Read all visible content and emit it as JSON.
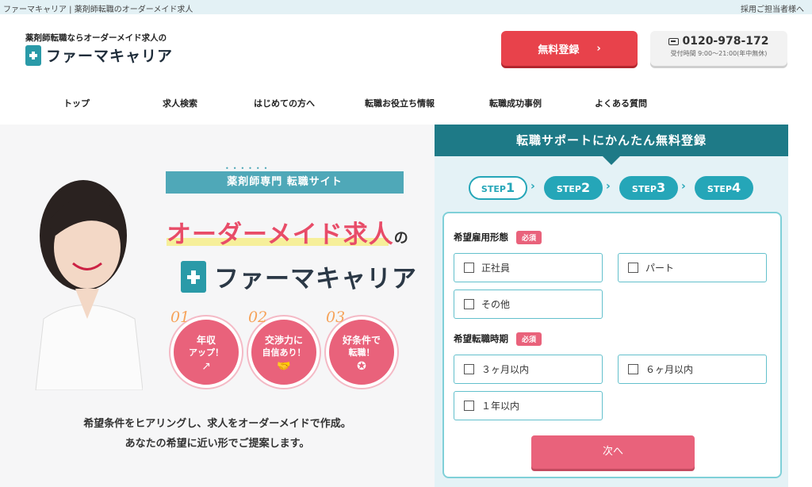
{
  "topbar": {
    "breadcrumb": "ファーマキャリア | 薬剤師転職のオーダーメイド求人",
    "employer_link": "採用ご担当者様へ"
  },
  "header": {
    "tagline": "薬剤師転職ならオーダーメイド求人の",
    "logo_text": "ファーマキャリア",
    "register_button": "無料登録",
    "tel_number": "0120-978-172",
    "tel_hours": "受付時間 9:00〜21:00(年中無休)"
  },
  "nav": {
    "items": [
      "トップ",
      "求人検索",
      "はじめての方へ",
      "転職お役立ち情報",
      "転職成功事例",
      "よくある質問"
    ]
  },
  "hero": {
    "site_badge": "薬剤師専門 転職サイト",
    "title_main": "オーダーメイド求人",
    "title_suffix": "の",
    "logo_text": "ファーマキャリア",
    "features": [
      {
        "num": "01",
        "line1": "年収",
        "line2": "アップ！",
        "icon": "chart-up-icon"
      },
      {
        "num": "02",
        "line1": "交渉力に",
        "line2": "自信あり！",
        "icon": "handshake-icon"
      },
      {
        "num": "03",
        "line1": "好条件で",
        "line2": "転職！",
        "icon": "search-star-icon"
      }
    ],
    "sub1": "希望条件をヒアリングし、求人をオーダーメイドで作成。",
    "sub2": "あなたの希望に近い形でご提案します。"
  },
  "panel": {
    "heading": "転職サポートにかんたん無料登録",
    "steps": [
      {
        "label": "STEP",
        "num": "1"
      },
      {
        "label": "STEP",
        "num": "2"
      },
      {
        "label": "STEP",
        "num": "3"
      },
      {
        "label": "STEP",
        "num": "4"
      }
    ],
    "q1": {
      "label": "希望雇用形態",
      "required": "必須",
      "options": [
        "正社員",
        "パート",
        "その他"
      ]
    },
    "q2": {
      "label": "希望転職時期",
      "required": "必須",
      "options": [
        "３ヶ月以内",
        "６ヶ月以内",
        "１年以内"
      ]
    },
    "next_button": "次へ"
  },
  "colors": {
    "primary": "#e8424b",
    "teal": "#1e7a87",
    "accent_pink": "#e9627b"
  }
}
